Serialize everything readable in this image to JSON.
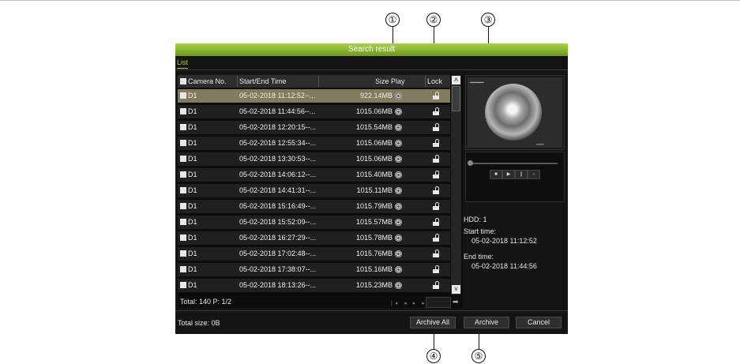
{
  "window": {
    "title": "Search result"
  },
  "tabs": [
    {
      "label": "List",
      "active": true
    }
  ],
  "table": {
    "columns": [
      "Camera No.",
      "Start/End Time",
      "Size",
      "Play",
      "Lock"
    ],
    "rows": [
      {
        "camera": "D1",
        "time": "05-02-2018 11:12:52--...",
        "size": "922.14MB",
        "selected": true
      },
      {
        "camera": "D1",
        "time": "05-02-2018 11:44:56--...",
        "size": "1015.06MB"
      },
      {
        "camera": "D1",
        "time": "05-02-2018 12:20:15--...",
        "size": "1015.54MB"
      },
      {
        "camera": "D1",
        "time": "05-02-2018 12:55:34--...",
        "size": "1015.06MB"
      },
      {
        "camera": "D1",
        "time": "05-02-2018 13:30:53--...",
        "size": "1015.06MB"
      },
      {
        "camera": "D1",
        "time": "05-02-2018 14:06:12--...",
        "size": "1015.40MB"
      },
      {
        "camera": "D1",
        "time": "05-02-2018 14:41:31--...",
        "size": "1015.11MB"
      },
      {
        "camera": "D1",
        "time": "05-02-2018 15:16:49--...",
        "size": "1015.79MB"
      },
      {
        "camera": "D1",
        "time": "05-02-2018 15:52:09--...",
        "size": "1015.57MB"
      },
      {
        "camera": "D1",
        "time": "05-02-2018 16:27:29--...",
        "size": "1015.78MB"
      },
      {
        "camera": "D1",
        "time": "05-02-2018 17:02:48--...",
        "size": "1015.76MB"
      },
      {
        "camera": "D1",
        "time": "05-02-2018 17:38:07--...",
        "size": "1015.16MB"
      },
      {
        "camera": "D1",
        "time": "05-02-2018 18:13:26--...",
        "size": "1015.23MB"
      }
    ]
  },
  "footer": {
    "total": "Total: 140  P: 1/2"
  },
  "details": {
    "hdd": "HDD: 1",
    "start_label": "Start time:",
    "start_value": "05-02-2018 11:12:52",
    "end_label": "End time:",
    "end_value": "05-02-2018 11:44:56"
  },
  "bottom": {
    "total_size": "Total size: 0B",
    "archive_all": "Archive All",
    "archive": "Archive",
    "cancel": "Cancel"
  },
  "callouts": [
    "①",
    "②",
    "③",
    "④",
    "⑤"
  ],
  "colors": {
    "accent": "#a6d23a",
    "title_bar": "#7aa82a",
    "selected_row": "#847a5c"
  }
}
